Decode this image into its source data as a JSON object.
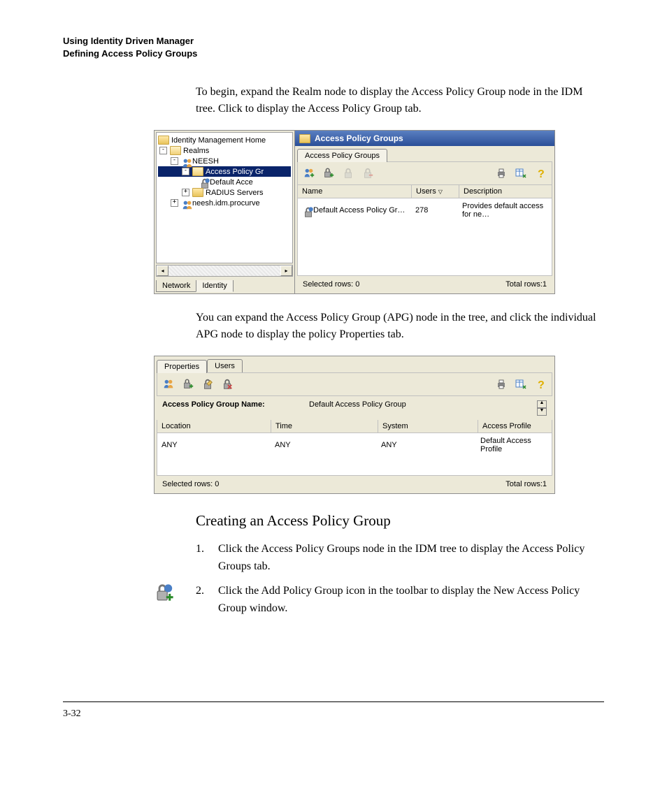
{
  "header": {
    "line1": "Using Identity Driven Manager",
    "line2": "Defining Access Policy Groups"
  },
  "para1": "To begin, expand the Realm node to display the Access Policy Group node in the IDM tree. Click to display the Access Policy Group tab.",
  "tree": {
    "root": "Identity Management Home",
    "realms": "Realms",
    "neesh": "NEESH",
    "apg": "Access Policy Gr",
    "defacc": "Default Acce",
    "radius": "RADIUS Servers",
    "neeshidm": "neesh.idm.procurve",
    "tab_network": "Network",
    "tab_identity": "Identity"
  },
  "panel1": {
    "title": "Access Policy Groups",
    "tab": "Access Policy Groups",
    "col_name": "Name",
    "col_users": "Users",
    "col_desc": "Description",
    "row_name": "Default Access Policy Gr…",
    "row_users": "278",
    "row_desc": "Provides default access for ne…",
    "selected": "Selected rows: 0",
    "total": "Total rows:1"
  },
  "para2": "You can expand the Access Policy Group (APG) node in the tree, and click the individual APG node to display the policy Properties tab.",
  "panel2": {
    "tab1": "Properties",
    "tab2": "Users",
    "label": "Access Policy Group Name:",
    "value": "Default Access Policy Group",
    "col_loc": "Location",
    "col_time": "Time",
    "col_sys": "System",
    "col_prof": "Access Profile",
    "row_loc": "ANY",
    "row_time": "ANY",
    "row_sys": "ANY",
    "row_prof": "Default Access Profile",
    "selected": "Selected rows: 0",
    "total": "Total rows:1"
  },
  "section": "Creating an Access Policy Group",
  "steps": {
    "n1": "1.",
    "s1": "Click the Access Policy Groups node in the IDM tree to display the Access Policy Groups tab.",
    "n2": "2.",
    "s2": "Click the Add Policy Group icon in the toolbar to display the New Access Policy Group window."
  },
  "pagenum": "3-32"
}
